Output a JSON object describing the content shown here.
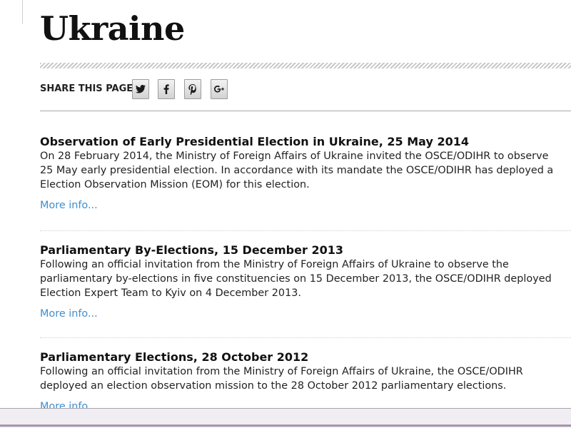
{
  "page": {
    "title": "Ukraine"
  },
  "share": {
    "label": "SHARE THIS PAGE",
    "buttons": [
      {
        "icon": "twitter-icon"
      },
      {
        "icon": "facebook-icon"
      },
      {
        "icon": "pinterest-icon"
      },
      {
        "icon": "google-plus-icon"
      }
    ]
  },
  "entries": [
    {
      "title": "Observation of Early Presidential Election in Ukraine, 25 May 2014",
      "lines": [
        "On 28 February 2014, the Ministry of Foreign Affairs of Ukraine invited the OSCE/ODIHR to observe",
        "25 May early presidential election. In accordance with its mandate the OSCE/ODIHR has deployed a",
        "Election Observation Mission (EOM) for this election."
      ],
      "link": "More info..."
    },
    {
      "title": "Parliamentary By-Elections, 15 December 2013",
      "lines": [
        "Following an official invitation from the Ministry of Foreign Affairs of Ukraine to observe the",
        "parliamentary by-elections in five constituencies on 15 December 2013, the OSCE/ODIHR deployed",
        "Election Expert Team to Kyiv on 4 December 2013."
      ],
      "link": "More info..."
    },
    {
      "title": "Parliamentary Elections, 28 October 2012",
      "lines": [
        "Following an official invitation from the Ministry of Foreign Affairs of Ukraine, the OSCE/ODIHR",
        "deployed an election observation mission to the 28 October 2012 parliamentary elections."
      ],
      "link": "More info..."
    }
  ],
  "colors": {
    "link": "#3f8fcf",
    "text": "#222222",
    "heading": "#111111"
  }
}
